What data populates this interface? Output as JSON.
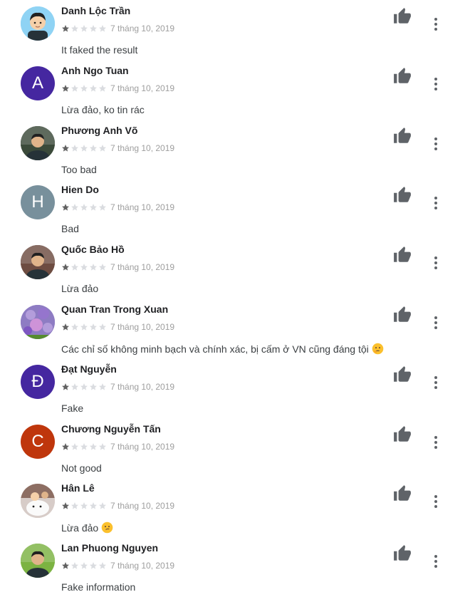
{
  "reviews": [
    {
      "name": "Danh Lộc Trần",
      "rating": 1,
      "max_rating": 5,
      "date": "7 tháng 10, 2019",
      "text": "It faked the result",
      "avatar": {
        "type": "photo",
        "icon": "cartoon-person-avatar",
        "bg": "#8fd3f4"
      }
    },
    {
      "name": "Anh Ngo Tuan",
      "rating": 1,
      "max_rating": 5,
      "date": "7 tháng 10, 2019",
      "text": "Lừa đảo, ko tin rác",
      "avatar": {
        "type": "letter",
        "letter": "A",
        "bg": "#4527a0"
      }
    },
    {
      "name": "Phương Anh Võ",
      "rating": 1,
      "max_rating": 5,
      "date": "7 tháng 10, 2019",
      "text": "Too bad",
      "avatar": {
        "type": "photo",
        "icon": "person-photo-avatar",
        "bg": "#3b4a3a"
      }
    },
    {
      "name": "Hien Do",
      "rating": 1,
      "max_rating": 5,
      "date": "7 tháng 10, 2019",
      "text": "Bad",
      "avatar": {
        "type": "letter",
        "letter": "H",
        "bg": "#78909c"
      }
    },
    {
      "name": "Quốc Bảo Hồ",
      "rating": 1,
      "max_rating": 5,
      "date": "7 tháng 10, 2019",
      "text": "Lừa đảo",
      "avatar": {
        "type": "photo",
        "icon": "person-photo-avatar",
        "bg": "#6d4c41"
      }
    },
    {
      "name": "Quan Tran Trong Xuan",
      "rating": 1,
      "max_rating": 5,
      "date": "7 tháng 10, 2019",
      "text": "Các chỉ số không minh bạch và chính xác, bị cấm ở VN cũng đáng tội",
      "emoji": "thinking-face-emoji",
      "avatar": {
        "type": "photo",
        "icon": "flowers-photo-avatar",
        "bg": "#8e7cc3"
      }
    },
    {
      "name": "Đạt Nguyễn",
      "rating": 1,
      "max_rating": 5,
      "date": "7 tháng 10, 2019",
      "text": "Fake",
      "avatar": {
        "type": "letter",
        "letter": "Đ",
        "bg": "#4527a0"
      }
    },
    {
      "name": "Chương Nguyễn Tấn",
      "rating": 1,
      "max_rating": 5,
      "date": "7 tháng 10, 2019",
      "text": "Not good",
      "avatar": {
        "type": "letter",
        "letter": "C",
        "bg": "#bf360c"
      }
    },
    {
      "name": "Hân Lê",
      "rating": 1,
      "max_rating": 5,
      "date": "7 tháng 10, 2019",
      "text": "Lừa đảo",
      "emoji": "smirking-face-emoji",
      "avatar": {
        "type": "photo",
        "icon": "dog-photo-avatar",
        "bg": "#d7ccc8"
      }
    },
    {
      "name": "Lan Phuong Nguyen",
      "rating": 1,
      "max_rating": 5,
      "date": "7 tháng 10, 2019",
      "text": "Fake information",
      "avatar": {
        "type": "photo",
        "icon": "person-photo-avatar",
        "bg": "#7cb342"
      }
    }
  ],
  "icons": {
    "thumb": "thumb-up-icon",
    "more": "more-vert-icon"
  },
  "colors": {
    "star_filled": "#616161",
    "star_empty": "#dadce0",
    "thumb": "#5f6368"
  }
}
